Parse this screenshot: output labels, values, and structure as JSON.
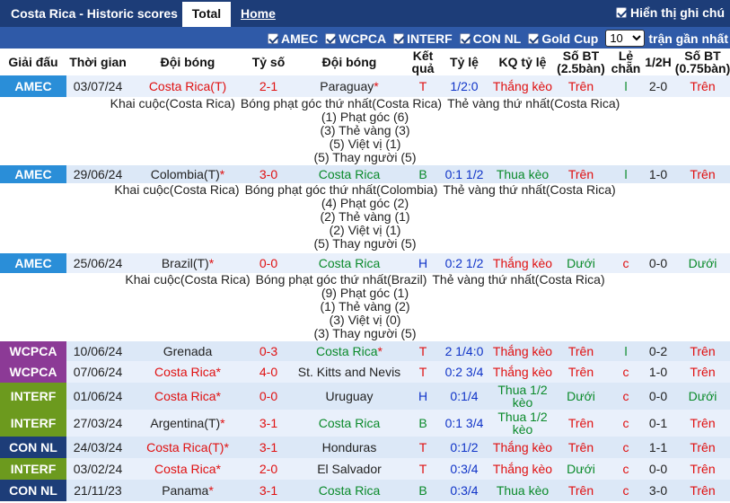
{
  "header": {
    "title": "Costa Rica - Historic scores",
    "tab_total": "Total",
    "tab_home": "Home",
    "toggle_label": "Hiển thị ghi chú"
  },
  "filters": {
    "items": [
      "AMEC",
      "WCPCA",
      "INTERF",
      "CON NL",
      "Gold Cup"
    ],
    "count_selected": "10",
    "count_suffix": "trận gần nhất"
  },
  "columns": {
    "league": "Giải đấu",
    "date": "Thời gian",
    "home": "Đội bóng",
    "score": "Tỷ số",
    "away": "Đội bóng",
    "result": "Kết quả",
    "odds": "Tỷ lệ",
    "odds_result": "KQ tỷ lệ",
    "corners": "Số BT (2.5bàn)",
    "odd_even": "Lẻ chẵn",
    "half": "1/2H",
    "corners2": "Số BT (0.75bàn)"
  },
  "matches": [
    {
      "league": "AMEC",
      "date": "03/07/24",
      "home": "Costa Rica(T)",
      "home_star": "",
      "score": "2-1",
      "away": "Paraguay",
      "away_star": "*",
      "result": "T",
      "odds": "1/2:0",
      "odds_result": "Thắng kèo",
      "ou": "Trên",
      "oe": "l",
      "half": "2-0",
      "ou2": "Trên"
    },
    {
      "league": "AMEC",
      "date": "29/06/24",
      "home": "Colombia(T)",
      "home_star": "*",
      "score": "3-0",
      "away": "Costa Rica",
      "away_star": "",
      "result": "B",
      "odds": "0:1 1/2",
      "odds_result": "Thua kèo",
      "ou": "Trên",
      "oe": "l",
      "half": "1-0",
      "ou2": "Trên"
    },
    {
      "league": "AMEC",
      "date": "25/06/24",
      "home": "Brazil(T)",
      "home_star": "*",
      "score": "0-0",
      "away": "Costa Rica",
      "away_star": "",
      "result": "H",
      "odds": "0:2 1/2",
      "odds_result": "Thắng kèo",
      "ou": "Dưới",
      "oe": "c",
      "half": "0-0",
      "ou2": "Dưới"
    },
    {
      "league": "WCPCA",
      "date": "10/06/24",
      "home": "Grenada",
      "home_star": "",
      "score": "0-3",
      "away": "Costa Rica",
      "away_star": "*",
      "result": "T",
      "odds": "2 1/4:0",
      "odds_result": "Thắng kèo",
      "ou": "Trên",
      "oe": "l",
      "half": "0-2",
      "ou2": "Trên"
    },
    {
      "league": "WCPCA",
      "date": "07/06/24",
      "home": "Costa Rica",
      "home_star": "*",
      "score": "4-0",
      "away": "St. Kitts and Nevis",
      "away_star": "",
      "result": "T",
      "odds": "0:2 3/4",
      "odds_result": "Thắng kèo",
      "ou": "Trên",
      "oe": "c",
      "half": "1-0",
      "ou2": "Trên"
    },
    {
      "league": "INTERF",
      "date": "01/06/24",
      "home": "Costa Rica",
      "home_star": "*",
      "score": "0-0",
      "away": "Uruguay",
      "away_star": "",
      "result": "H",
      "odds": "0:1/4",
      "odds_result": "Thua 1/2 kèo",
      "ou": "Dưới",
      "oe": "c",
      "half": "0-0",
      "ou2": "Dưới"
    },
    {
      "league": "INTERF",
      "date": "27/03/24",
      "home": "Argentina(T)",
      "home_star": "*",
      "score": "3-1",
      "away": "Costa Rica",
      "away_star": "",
      "result": "B",
      "odds": "0:1 3/4",
      "odds_result": "Thua 1/2 kèo",
      "ou": "Trên",
      "oe": "c",
      "half": "0-1",
      "ou2": "Trên"
    },
    {
      "league": "CON NL",
      "date": "24/03/24",
      "home": "Costa Rica(T)",
      "home_star": "*",
      "score": "3-1",
      "away": "Honduras",
      "away_star": "",
      "result": "T",
      "odds": "0:1/2",
      "odds_result": "Thắng kèo",
      "ou": "Trên",
      "oe": "c",
      "half": "1-1",
      "ou2": "Trên"
    },
    {
      "league": "INTERF",
      "date": "03/02/24",
      "home": "Costa Rica",
      "home_star": "*",
      "score": "2-0",
      "away": "El Salvador",
      "away_star": "",
      "result": "T",
      "odds": "0:3/4",
      "odds_result": "Thắng kèo",
      "ou": "Dưới",
      "oe": "c",
      "half": "0-0",
      "ou2": "Trên"
    },
    {
      "league": "CON NL",
      "date": "21/11/23",
      "home": "Panama",
      "home_star": "*",
      "score": "3-1",
      "away": "Costa Rica",
      "away_star": "",
      "result": "B",
      "odds": "0:3/4",
      "odds_result": "Thua kèo",
      "ou": "Trên",
      "oe": "c",
      "half": "3-0",
      "ou2": "Trên"
    }
  ],
  "notes": [
    {
      "line1": [
        "Khai cuộc(Costa Rica)",
        "Bóng phạt góc thứ nhất(Costa Rica)",
        "Thẻ vàng thứ nhất(Costa Rica)"
      ],
      "lines": [
        "(1) Phạt góc (6)",
        "(3) Thẻ vàng (3)",
        "(5) Việt vị (1)",
        "(5) Thay người (5)"
      ]
    },
    {
      "line1": [
        "Khai cuộc(Costa Rica)",
        "Bóng phạt góc thứ nhất(Colombia)",
        "Thẻ vàng thứ nhất(Costa Rica)"
      ],
      "lines": [
        "(4) Phạt góc (2)",
        "(2) Thẻ vàng (1)",
        "(2) Việt vị (1)",
        "(5) Thay người (5)"
      ]
    },
    {
      "line1": [
        "Khai cuộc(Costa Rica)",
        "Bóng phạt góc thứ nhất(Brazil)",
        "Thẻ vàng thứ nhất(Costa Rica)"
      ],
      "lines": [
        "(9) Phạt góc (1)",
        "(1) Thẻ vàng (2)",
        "(3) Việt vị (0)",
        "(3) Thay người (5)"
      ]
    }
  ]
}
